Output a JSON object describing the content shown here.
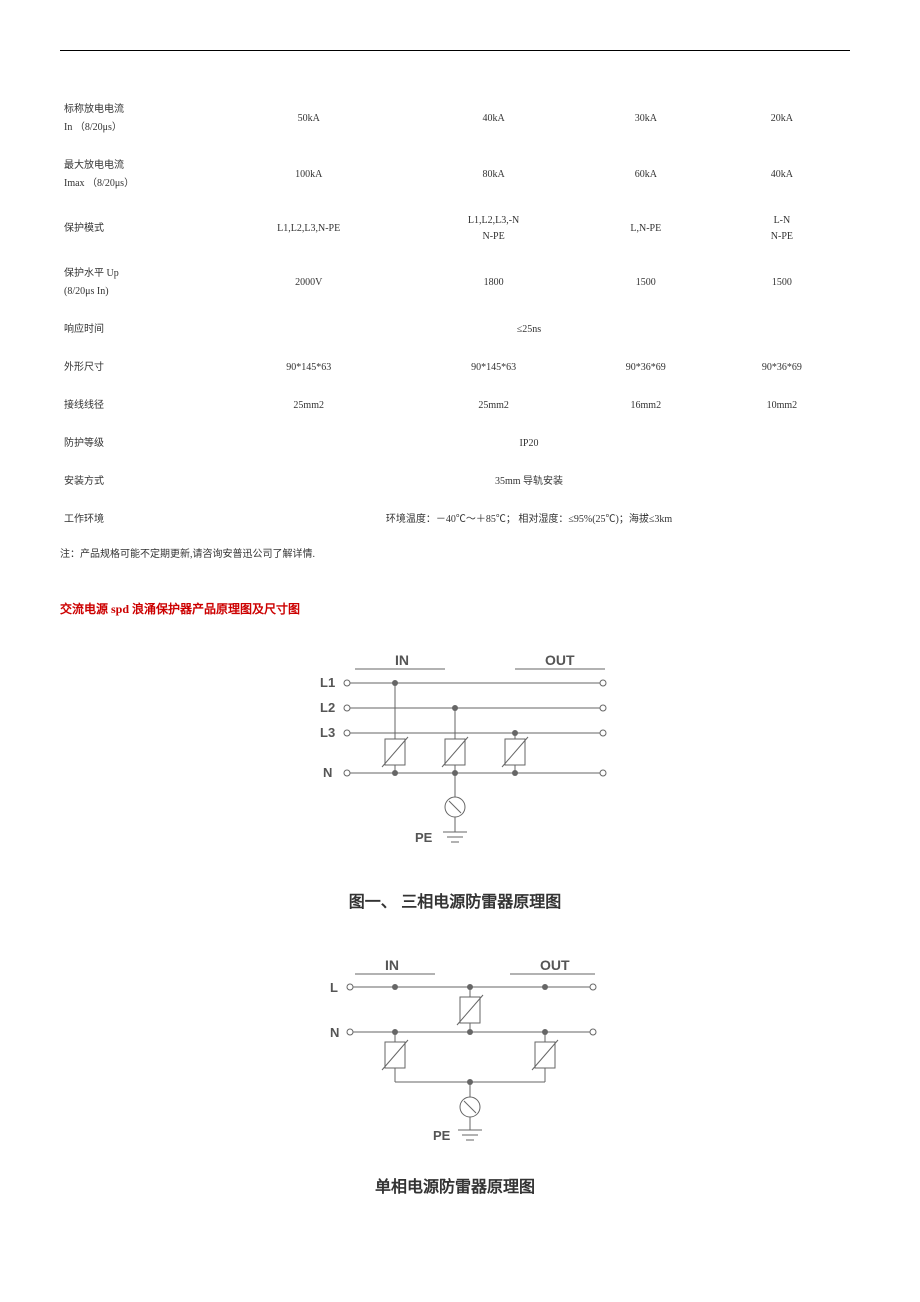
{
  "table": {
    "rows": [
      {
        "label": "标称放电电流\nIn （8/20μs）",
        "c1": "50kA",
        "c2": "40kA",
        "c3": "30kA",
        "c4": "20kA"
      },
      {
        "label": "最大放电电流\nImax （8/20μs）",
        "c1": "100kA",
        "c2": "80kA",
        "c3": "60kA",
        "c4": "40kA"
      },
      {
        "label": "保护模式",
        "c1": "L1,L2,L3,N-PE",
        "c2": "L1,L2,L3,-N\nN-PE",
        "c3": "L,N-PE",
        "c4": "L-N\nN-PE"
      },
      {
        "label": "保护水平 Up\n(8/20μs In)",
        "c1": "2000V",
        "c2": "1800",
        "c3": "1500",
        "c4": "1500"
      },
      {
        "label": "响应时间",
        "span": "≤25ns"
      },
      {
        "label": "外形尺寸",
        "c1": "90*145*63",
        "c2": "90*145*63",
        "c3": "90*36*69",
        "c4": "90*36*69"
      },
      {
        "label": "接线线径",
        "c1": "25mm2",
        "c2": "25mm2",
        "c3": "16mm2",
        "c4": "10mm2"
      },
      {
        "label": "防护等级",
        "span": "IP20"
      },
      {
        "label": "安装方式",
        "span": "35mm 导轨安装"
      },
      {
        "label": "工作环境",
        "span": "环境温度：－40℃～＋85℃； 相对湿度：≤95%(25℃)；海拔≤3km"
      }
    ]
  },
  "note": "注：产品规格可能不定期更新,请咨询安普迅公司了解详情.",
  "section_title": "交流电源 spd 浪涌保护器产品原理图及尺寸图",
  "fig1": {
    "in": "IN",
    "out": "OUT",
    "L1": "L1",
    "L2": "L2",
    "L3": "L3",
    "N": "N",
    "PE": "PE",
    "caption": "图一、 三相电源防雷器原理图"
  },
  "fig2": {
    "in": "IN",
    "out": "OUT",
    "L": "L",
    "N": "N",
    "PE": "PE",
    "caption": "单相电源防雷器原理图"
  }
}
